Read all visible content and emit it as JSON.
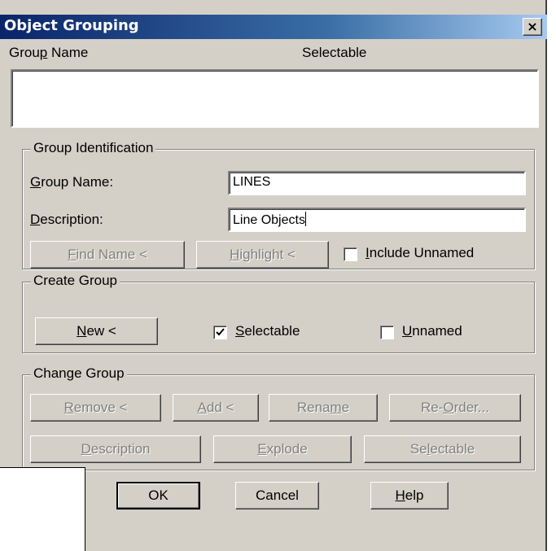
{
  "window": {
    "title": "Object Grouping",
    "close_glyph": "×"
  },
  "list": {
    "col_group_name_pre": "Grou",
    "col_group_name_ul": "p",
    "col_group_name_post": " Name",
    "col_selectable": "Selectable"
  },
  "identification": {
    "title": "Group Identification",
    "group_name_ul": "G",
    "group_name_rest": "roup Name:",
    "group_name_value": "LINES",
    "description_ul": "D",
    "description_rest": "escription:",
    "description_value": "Line Objects",
    "find_name_ul": "F",
    "find_name_rest": "ind Name <",
    "highlight_ul": "H",
    "highlight_rest": "ighlight <",
    "include_unnamed_ul": "I",
    "include_unnamed_rest": "nclude Unnamed",
    "include_unnamed_checked": false
  },
  "create": {
    "title": "Create Group",
    "new_ul": "N",
    "new_rest": "ew <",
    "selectable_ul": "S",
    "selectable_rest": "electable",
    "selectable_checked": true,
    "unnamed_ul": "U",
    "unnamed_rest": "nnamed",
    "unnamed_checked": false
  },
  "change": {
    "title": "Change Group",
    "remove_ul": "R",
    "remove_rest": "emove <",
    "add_ul": "A",
    "add_rest": "dd <",
    "rename_pre": "Rena",
    "rename_ul": "m",
    "rename_post": "e",
    "reorder_pre": "Re-",
    "reorder_ul": "O",
    "reorder_post": "rder...",
    "description_ul": "D",
    "description_rest": "escription",
    "explode_ul": "E",
    "explode_rest": "xplode",
    "selectable_pre": "Se",
    "selectable_ul": "l",
    "selectable_post": "ectable"
  },
  "footer": {
    "ok": "OK",
    "cancel": "Cancel",
    "help_ul": "H",
    "help_rest": "elp"
  }
}
